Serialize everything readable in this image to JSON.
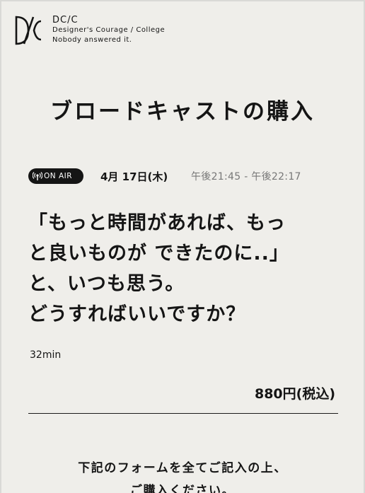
{
  "brand": {
    "name": "DC/C",
    "tagline": "Designer's Courage / College",
    "motto": "Nobody answered it."
  },
  "page_title": "ブロードキャストの購入",
  "broadcast": {
    "badge": "ON AIR",
    "date": "4月 17日(木)",
    "time": "午後21:45 - 午後22:17",
    "title_lines": [
      "「もっと時間があれば、もっ",
      "と良いものが できたのに..」",
      "と、いつも思う。",
      "どうすればいいですか？"
    ],
    "duration": "32min",
    "price": "880円(税込)"
  },
  "instruction_lines": [
    "下記のフォームを全てご記入の上、",
    "ご購入ください。"
  ],
  "colors": {
    "background": "#efeeea",
    "text": "#151515",
    "badge_bg": "#151515",
    "muted": "#777777"
  }
}
